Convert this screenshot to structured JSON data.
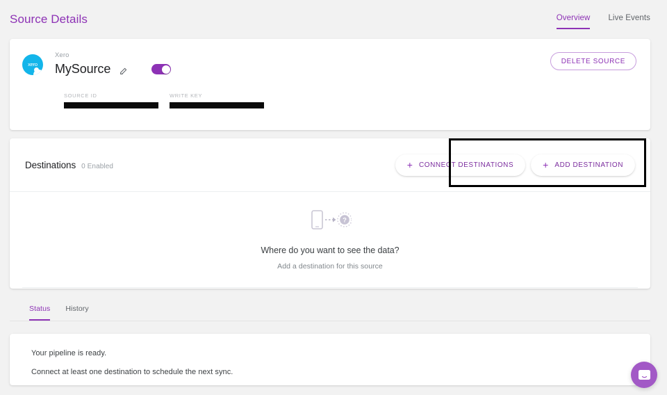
{
  "header": {
    "title": "Source Details",
    "tabs": [
      {
        "label": "Overview",
        "active": true
      },
      {
        "label": "Live Events",
        "active": false
      }
    ]
  },
  "source": {
    "logo_icon": "xero-logo-icon",
    "logo_wordmark": "xero",
    "kind": "Xero",
    "name": "MySource",
    "edit_icon": "pencil-icon",
    "enabled_toggle": true,
    "delete_button": "DELETE SOURCE",
    "fields": [
      {
        "label": "SOURCE ID",
        "value": "",
        "redacted": true
      },
      {
        "label": "WRITE KEY",
        "value": "",
        "redacted": true
      }
    ]
  },
  "destinations": {
    "title": "Destinations",
    "count_label": "0 Enabled",
    "connect_button": "CONNECT DESTINATIONS",
    "add_button": "ADD DESTINATION",
    "plus_icon": "plus-icon",
    "empty": {
      "icon": "phone-to-unknown-destination-icon",
      "title": "Where do you want to see the data?",
      "subtitle": "Add a destination for this source"
    }
  },
  "bottom": {
    "tabs": [
      {
        "label": "Status",
        "active": true
      },
      {
        "label": "History",
        "active": false
      }
    ],
    "status_lines": [
      "Your pipeline is ready.",
      "Connect at least one destination to schedule the next sync."
    ]
  },
  "support": {
    "launcher_icon": "intercom-chat-icon"
  },
  "colors": {
    "accent_purple": "#8d32b5",
    "brand_xero_blue": "#13b5ea",
    "page_background": "#f2f2f2",
    "card_background": "#ffffff",
    "intercom_purple": "#a259c6",
    "highlight_outline": "#000000"
  }
}
